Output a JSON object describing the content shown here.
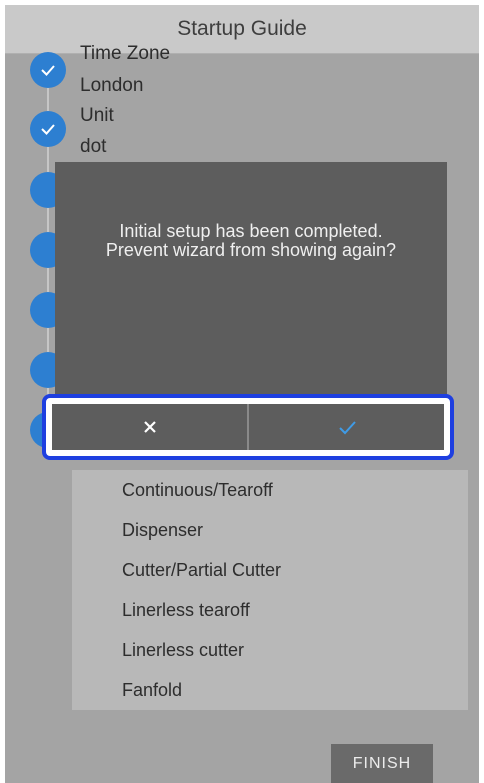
{
  "header": {
    "title": "Startup Guide"
  },
  "steps": [
    {
      "label": "Time Zone",
      "value": "London"
    },
    {
      "label": "Unit",
      "value": "dot"
    }
  ],
  "options": [
    "Continuous/Tearoff",
    "Dispenser",
    "Cutter/Partial Cutter",
    "Linerless tearoff",
    "Linerless cutter",
    "Fanfold"
  ],
  "dialog": {
    "line1": "Initial setup has been completed.",
    "line2": "Prevent wizard from showing again?",
    "cancel_icon": "close-icon",
    "confirm_icon": "check-icon"
  },
  "footer": {
    "finish_label": "FINISH"
  },
  "colors": {
    "accent": "#2d7fd1",
    "highlight_border": "#1e3fe0",
    "dialog_bg": "#5d5d5d"
  }
}
